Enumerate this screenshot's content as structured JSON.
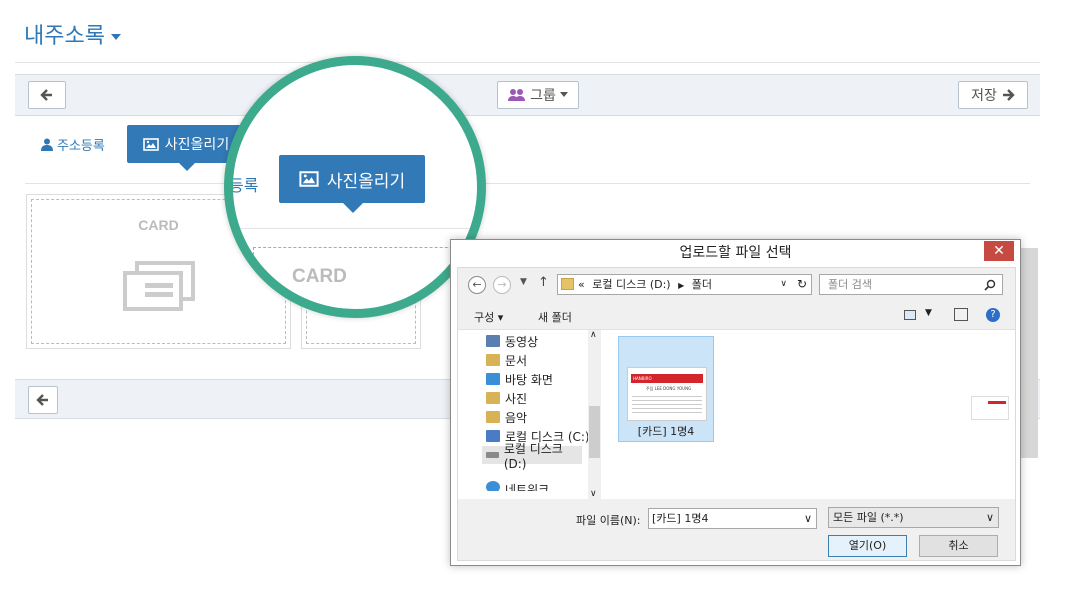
{
  "page": {
    "title": "내주소록"
  },
  "toolbar": {
    "group_label": "그룹",
    "save_label": "저장"
  },
  "tabs": {
    "address": "주소등록",
    "photo": "사진올리기"
  },
  "zoom": {
    "address_partial": "등록",
    "photo": "사진올리기"
  },
  "cards": {
    "card1": "CARD",
    "card2": "CARD"
  },
  "dialog": {
    "title": "업로드할 파일 선택",
    "close": "✕",
    "address": [
      "«",
      "로컬 디스크 (D:)",
      "폴더"
    ],
    "search_placeholder": "폴더 검색",
    "organize": "구성",
    "new_folder": "새 폴더",
    "tree": [
      {
        "label": "동영상",
        "color": "#5a7fb0"
      },
      {
        "label": "문서",
        "color": "#d7b355"
      },
      {
        "label": "바탕 화면",
        "color": "#3a8fd6"
      },
      {
        "label": "사진",
        "color": "#d7b355"
      },
      {
        "label": "음악",
        "color": "#d7b355"
      },
      {
        "label": "로컬 디스크 (C:)",
        "color": "#4a7cc4"
      },
      {
        "label": "로컬 디스크 (D:)",
        "color": "#8a8a8a"
      },
      {
        "label": "네트워크",
        "color": "#3a8fd6"
      }
    ],
    "file": {
      "name": "[카드] 1명4",
      "thumb_brand": "HANBIRO",
      "thumb_person": "주임 LEE DONG YOUNG"
    },
    "filename_label": "파일 이름(N):",
    "filename_value": "[카드] 1명4",
    "filetype_value": "모든 파일 (*.*)",
    "open_button": "열기(O)",
    "cancel_button": "취소"
  },
  "colors": {
    "accent": "#3279b7",
    "circle": "#3daa8e",
    "close": "#c74a42"
  }
}
